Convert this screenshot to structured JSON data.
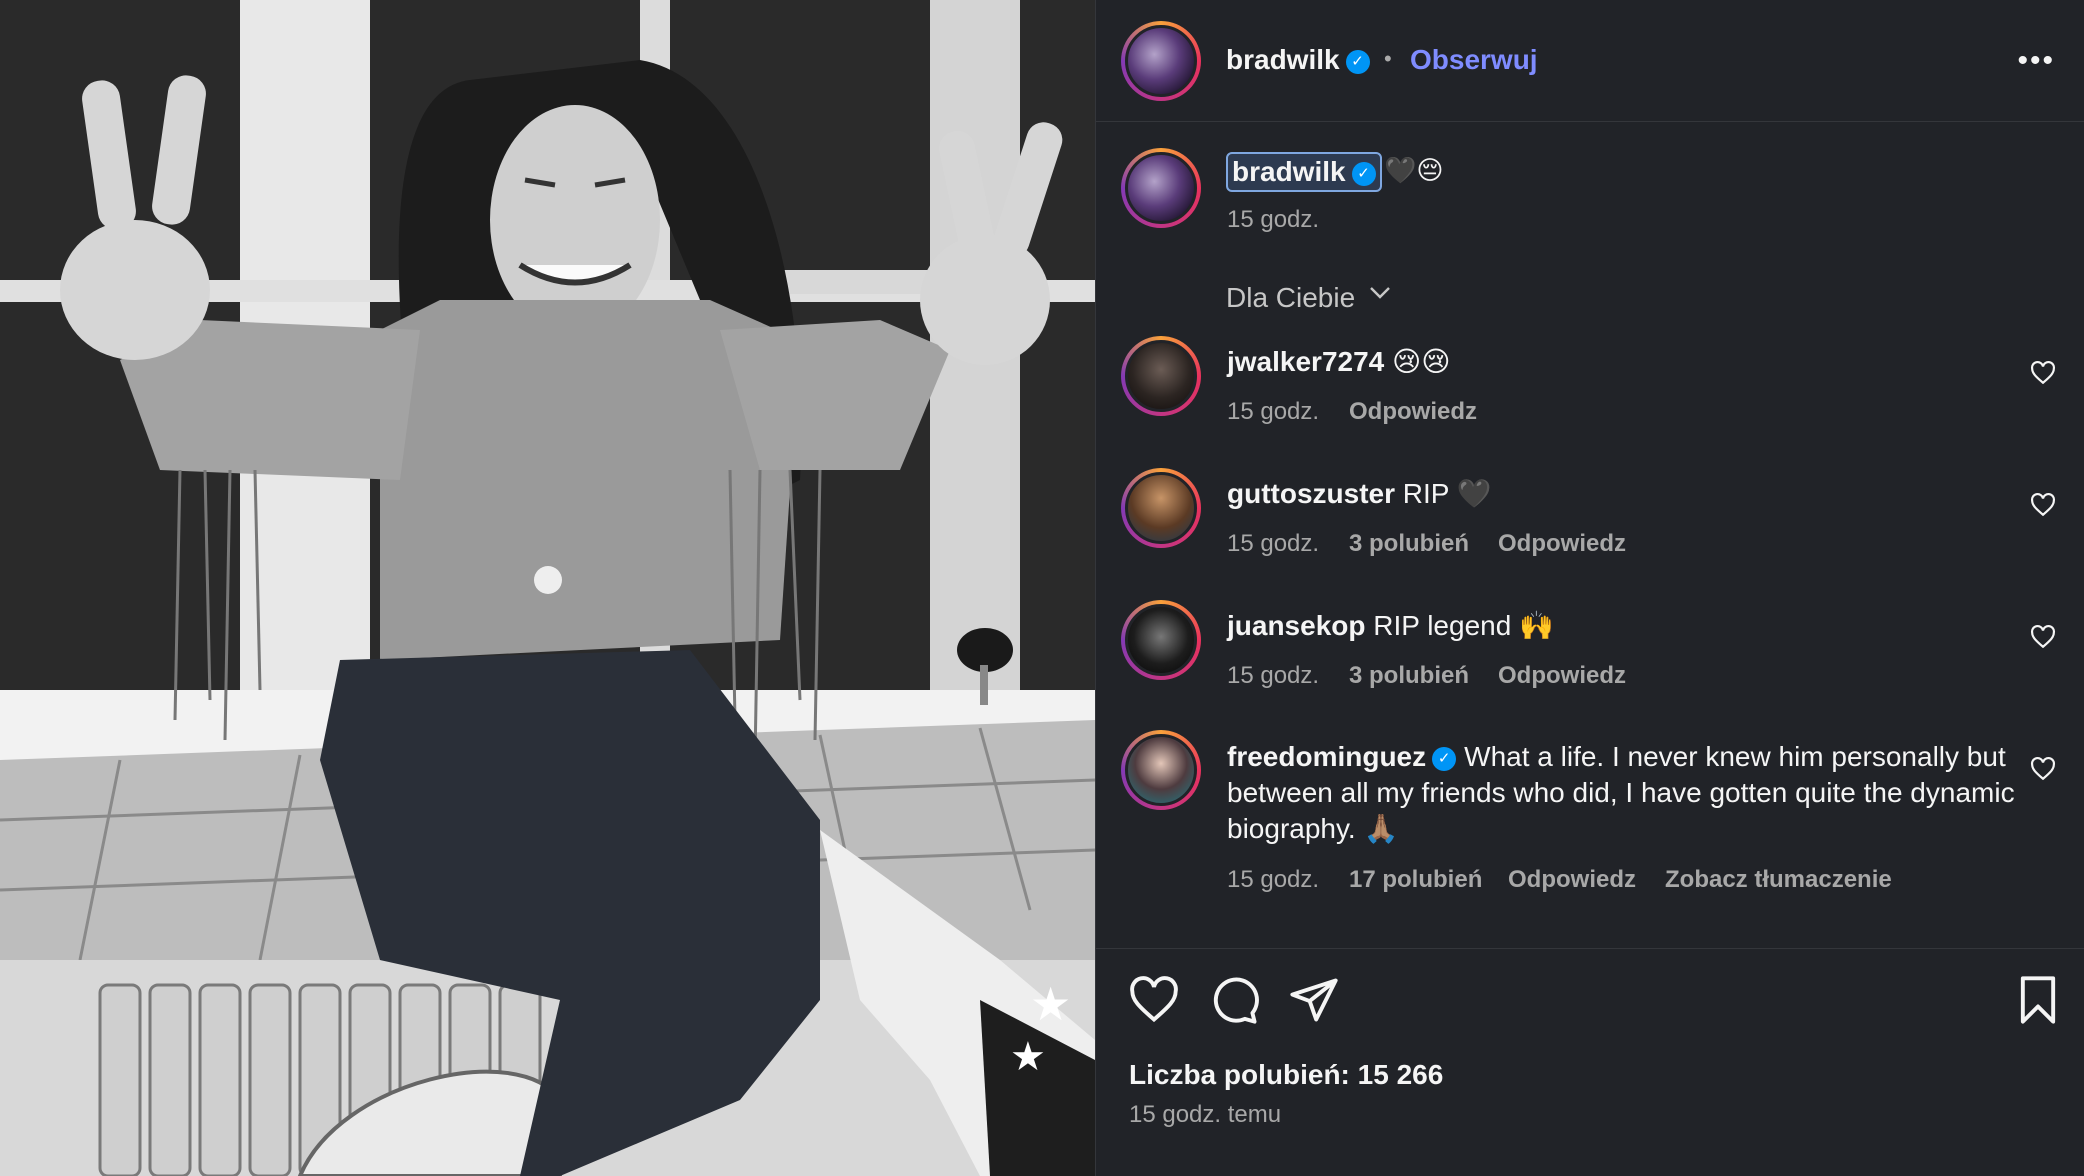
{
  "photo": {
    "alt_icon": "post-photo"
  },
  "header": {
    "username": "bradwilk",
    "verified_mark": "✓",
    "separator": "•",
    "follow_label": "Obserwuj",
    "more_icon": "more-horizontal-icon"
  },
  "caption": {
    "username": "bradwilk",
    "emoji": "🖤😔",
    "time": "15 godz."
  },
  "sort": {
    "label": "Dla Ciebie"
  },
  "comments": [
    {
      "username": "jwalker7274",
      "text": "😢😢",
      "verified": false,
      "time": "15 godz.",
      "likes": "",
      "reply": "Odpowiedz",
      "translate": ""
    },
    {
      "username": "guttoszuster",
      "text": "RIP 🖤",
      "verified": false,
      "time": "15 godz.",
      "likes": "3 polubień",
      "reply": "Odpowiedz",
      "translate": ""
    },
    {
      "username": "juansekop",
      "text": "RIP legend 🙌",
      "verified": false,
      "time": "15 godz.",
      "likes": "3 polubień",
      "reply": "Odpowiedz",
      "translate": ""
    },
    {
      "username": "freedominguez",
      "text": "What a life. I never knew him personally but between all my friends who did, I have gotten quite the dynamic biography. 🙏🏽",
      "verified": true,
      "time": "15 godz.",
      "likes": "17 polubień",
      "reply": "Odpowiedz",
      "translate": "Zobacz tłumaczenie"
    }
  ],
  "footer": {
    "likes_label": "Liczba polubień: 15 266",
    "ago": "15 godz. temu",
    "icons": [
      "heart-icon",
      "comment-icon",
      "share-icon",
      "bookmark-icon"
    ]
  },
  "colors": {
    "panel_bg": "#212328",
    "follow": "#7f8cff",
    "verified": "#0095f6"
  }
}
